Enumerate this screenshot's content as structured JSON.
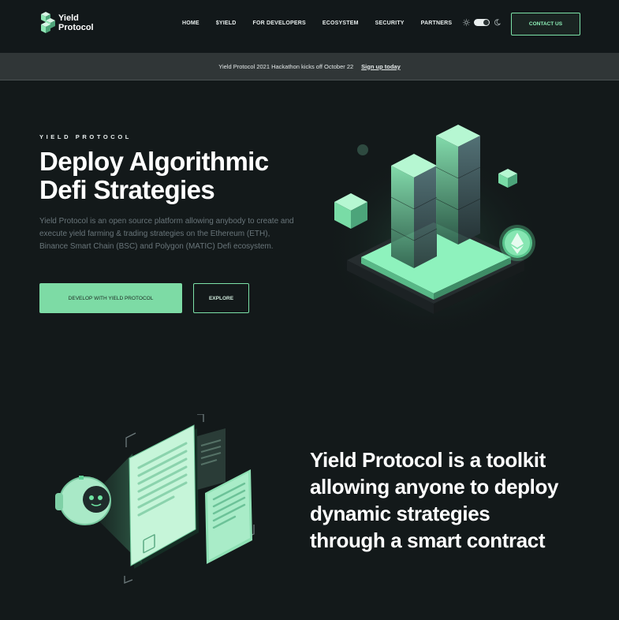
{
  "nav": {
    "logo_line1": "Yield",
    "logo_line2": "Protocol",
    "items": [
      {
        "label": "HOME"
      },
      {
        "label": "$YIELD"
      },
      {
        "label": "FOR DEVELOPERS"
      },
      {
        "label": "ECOSYSTEM"
      },
      {
        "label": "SECURITY"
      },
      {
        "label": "PARTNERS"
      }
    ],
    "theme_icons": [
      "sun-icon",
      "moon-icon"
    ],
    "contact_label": "CONTACT US"
  },
  "banner": {
    "text": "Yield Protocol 2021 Hackathon kicks off October 22",
    "link": "Sign up today"
  },
  "hero": {
    "eyebrow": "YIELD PROTOCOL",
    "title_line1": "Deploy Algorithmic",
    "title_line2": "Defi Strategies",
    "description": "Yield Protocol is an open source platform allowing anybody to create and execute yield farming & trading strategies on the Ethereum (ETH), Binance Smart Chain (BSC) and Polygon (MATIC) Defi ecosystem.",
    "primary_button": "DEVELOP WITH YIELD PROTOCOL",
    "secondary_button": "EXPLORE"
  },
  "feature": {
    "line1": "Yield Protocol is a toolkit",
    "line2": "allowing anyone to deploy",
    "line3": "dynamic strategies",
    "line4": "through a smart contract"
  },
  "colors": {
    "background": "#13191a",
    "accent": "#7ddba5",
    "banner": "#303637",
    "muted_text": "#69757a"
  }
}
